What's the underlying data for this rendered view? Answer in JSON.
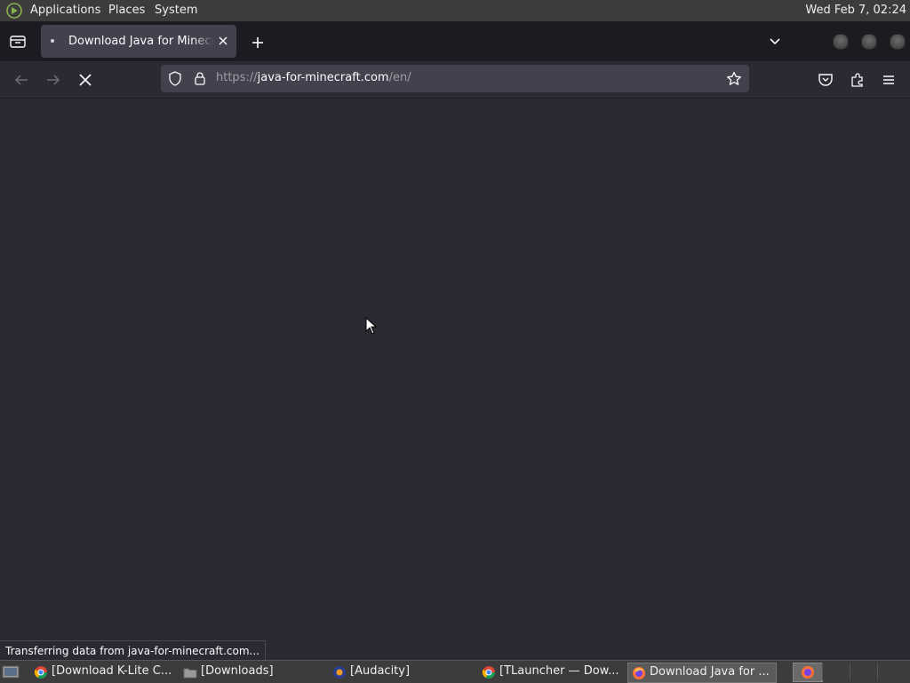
{
  "system_panel": {
    "menus": [
      "Applications",
      "Places",
      "System"
    ],
    "clock": "Wed Feb  7, 02:24"
  },
  "browser": {
    "tabs": [
      {
        "title": "Download Java for Minecraft",
        "active": true,
        "loading": true
      }
    ],
    "url": {
      "scheme": "https://",
      "host": "java-for-minecraft.com",
      "path": "/en/"
    },
    "status_text": "Transferring data from java-for-minecraft.com..."
  },
  "taskbar": {
    "tasks": [
      {
        "label": "[Download K-Lite C...",
        "icon": "chrome-icon"
      },
      {
        "label": "[Downloads]",
        "icon": "folder-icon"
      },
      {
        "label": "[Audacity]",
        "icon": "audacity-icon"
      },
      {
        "label": "[TLauncher — Dow...",
        "icon": "chrome-icon"
      },
      {
        "label": "Download Java for ...",
        "icon": "firefox-icon",
        "active": true
      }
    ]
  },
  "colors": {
    "browser_bg": "#2b2a33",
    "tab_strip": "#1c1b22",
    "url_field": "#42414d",
    "panel": "#3c3c3c"
  }
}
